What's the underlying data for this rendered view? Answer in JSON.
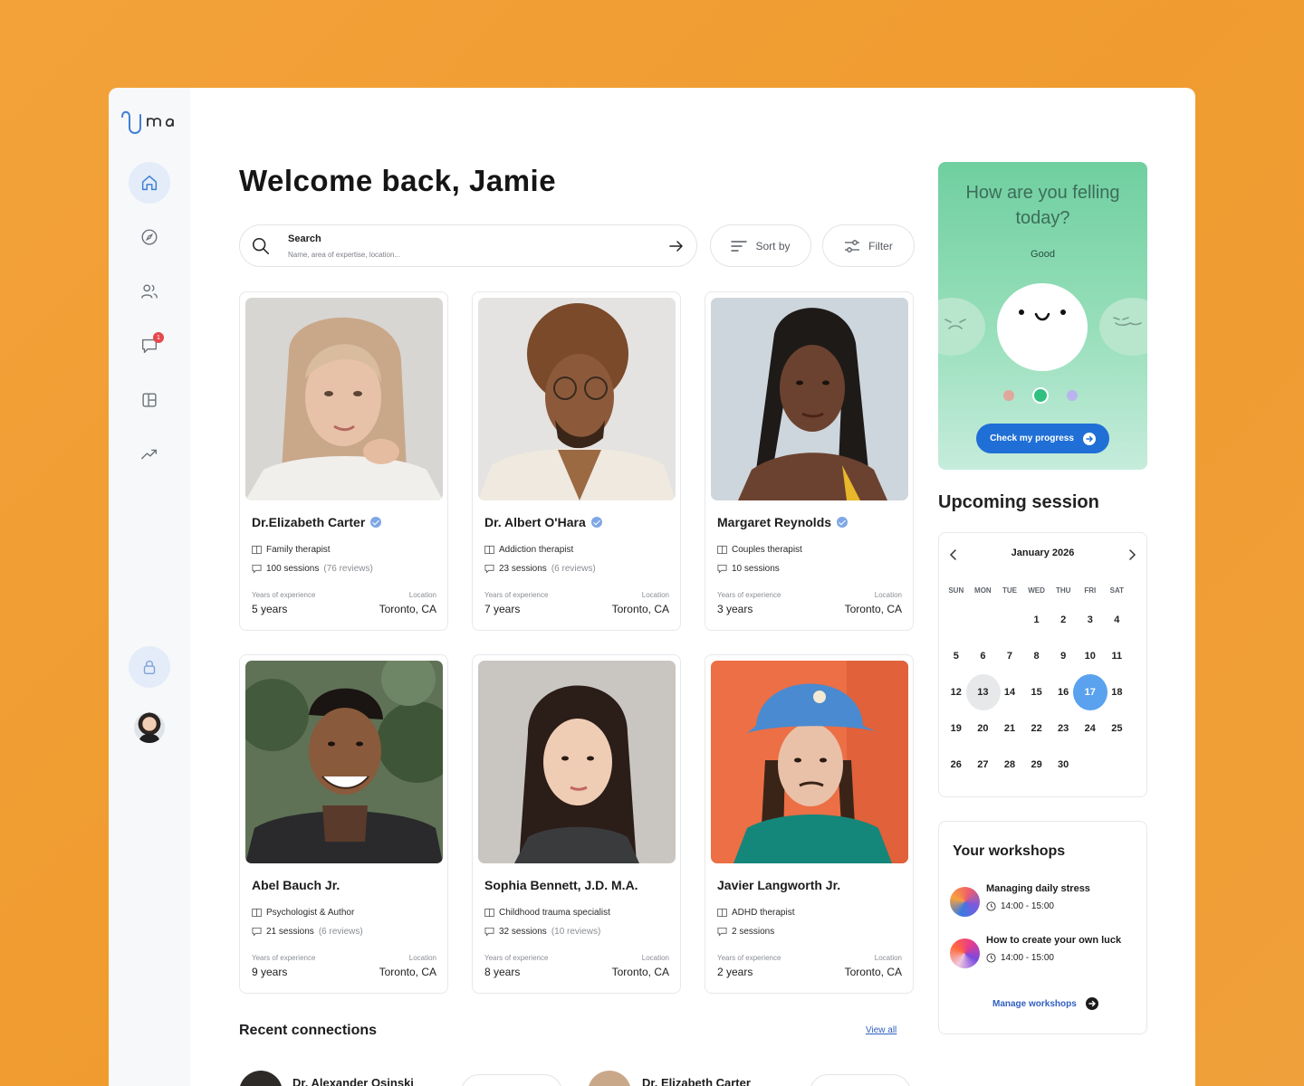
{
  "app": {
    "logo_text": "uma"
  },
  "header": {
    "welcome": "Welcome back, Jamie"
  },
  "search": {
    "label": "Search",
    "placeholder": "Name, area of expertise, location..."
  },
  "toolbar": {
    "sort_label": "Sort by",
    "filter_label": "Filter"
  },
  "sidebar": {
    "chat_badge": "1"
  },
  "cards": [
    {
      "name": "Dr.Elizabeth Carter",
      "verified": true,
      "specialty": "Family therapist",
      "sessions": "100 sessions",
      "reviews": "(76 reviews)",
      "exp_label": "Years of experience",
      "exp": "5 years",
      "loc_label": "Location",
      "loc": "Toronto, CA"
    },
    {
      "name": "Dr. Albert O'Hara",
      "verified": true,
      "specialty": "Addiction therapist",
      "sessions": "23 sessions",
      "reviews": "(6 reviews)",
      "exp_label": "Years of experience",
      "exp": "7 years",
      "loc_label": "Location",
      "loc": "Toronto, CA"
    },
    {
      "name": "Margaret Reynolds",
      "verified": true,
      "specialty": "Couples therapist",
      "sessions": "10 sessions",
      "reviews": "",
      "exp_label": "Years of experience",
      "exp": "3 years",
      "loc_label": "Location",
      "loc": "Toronto, CA"
    },
    {
      "name": "Abel Bauch Jr.",
      "verified": false,
      "specialty": "Psychologist & Author",
      "sessions": "21 sessions",
      "reviews": "(6 reviews)",
      "exp_label": "Years of experience",
      "exp": "9 years",
      "loc_label": "Location",
      "loc": "Toronto, CA"
    },
    {
      "name": "Sophia Bennett, J.D. M.A.",
      "verified": false,
      "specialty": "Childhood trauma specialist",
      "sessions": "32 sessions",
      "reviews": "(10 reviews)",
      "exp_label": "Years of experience",
      "exp": "8 years",
      "loc_label": "Location",
      "loc": "Toronto, CA"
    },
    {
      "name": "Javier Langworth Jr.",
      "verified": false,
      "specialty": "ADHD therapist",
      "sessions": "2 sessions",
      "reviews": "",
      "exp_label": "Years of experience",
      "exp": "2 years",
      "loc_label": "Location",
      "loc": "Toronto, CA"
    }
  ],
  "recent": {
    "title": "Recent connections",
    "view_all": "View all",
    "items": [
      {
        "name": "Dr. Alexander Osinski"
      },
      {
        "name": "Dr. Elizabeth Carter"
      }
    ]
  },
  "mood": {
    "question": "How are you felling today?",
    "level": "Good",
    "button": "Check my progress",
    "colors": {
      "bad": "#e0a89a",
      "good": "#2fbf7f",
      "ok": "#b9b4ef"
    }
  },
  "calendar": {
    "title": "Upcoming session",
    "month": "January 2026",
    "weekdays": [
      "SUN",
      "MON",
      "TUE",
      "WED",
      "THU",
      "FRI",
      "SAT"
    ],
    "today": "13",
    "selected": "17",
    "days": [
      "",
      "",
      "",
      "1",
      "2",
      "3",
      "4",
      "5",
      "6",
      "7",
      "8",
      "9",
      "10",
      "11",
      "12",
      "13",
      "14",
      "15",
      "16",
      "17",
      "18",
      "19",
      "20",
      "21",
      "22",
      "23",
      "24",
      "25",
      "26",
      "27",
      "28",
      "29",
      "30"
    ]
  },
  "workshops": {
    "title": "Your workshops",
    "items": [
      {
        "title": "Managing daily stress",
        "time": "14:00 - 15:00"
      },
      {
        "title": "How to create your own luck",
        "time": "14:00 - 15:00"
      }
    ],
    "manage": "Manage workshops"
  }
}
